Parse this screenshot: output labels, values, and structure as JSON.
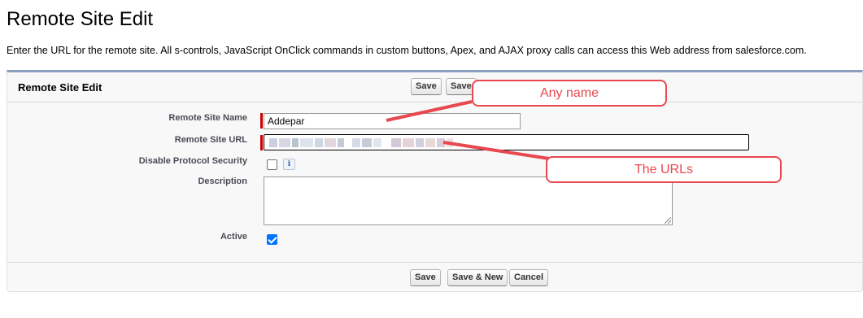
{
  "page": {
    "title": "Remote Site Edit",
    "intro": "Enter the URL for the remote site. All s-controls, JavaScript OnClick commands in custom buttons, Apex, and AJAX proxy calls can access this Web address from salesforce.com."
  },
  "panel": {
    "title": "Remote Site Edit",
    "top_buttons": {
      "save": "Save",
      "save_new": "Save"
    },
    "bottom_buttons": {
      "save": "Save",
      "save_new": "Save & New",
      "cancel": "Cancel"
    }
  },
  "form": {
    "remote_site_name": {
      "label": "Remote Site Name",
      "value": "Addepar",
      "required": true
    },
    "remote_site_url": {
      "label": "Remote Site URL",
      "value": "",
      "required": true,
      "value_obscured": true
    },
    "disable_protocol_security": {
      "label": "Disable Protocol Security",
      "checked": false,
      "info_icon": "i"
    },
    "description": {
      "label": "Description",
      "value": ""
    },
    "active": {
      "label": "Active",
      "checked": true
    }
  },
  "annotations": {
    "name_callout": "Any name",
    "url_callout": "The URLs",
    "color": "#e8484f"
  },
  "colors": {
    "required": "#cc0000",
    "panel_border_top": "#8a9ebe",
    "checkbox_checked": "#0075ff"
  }
}
